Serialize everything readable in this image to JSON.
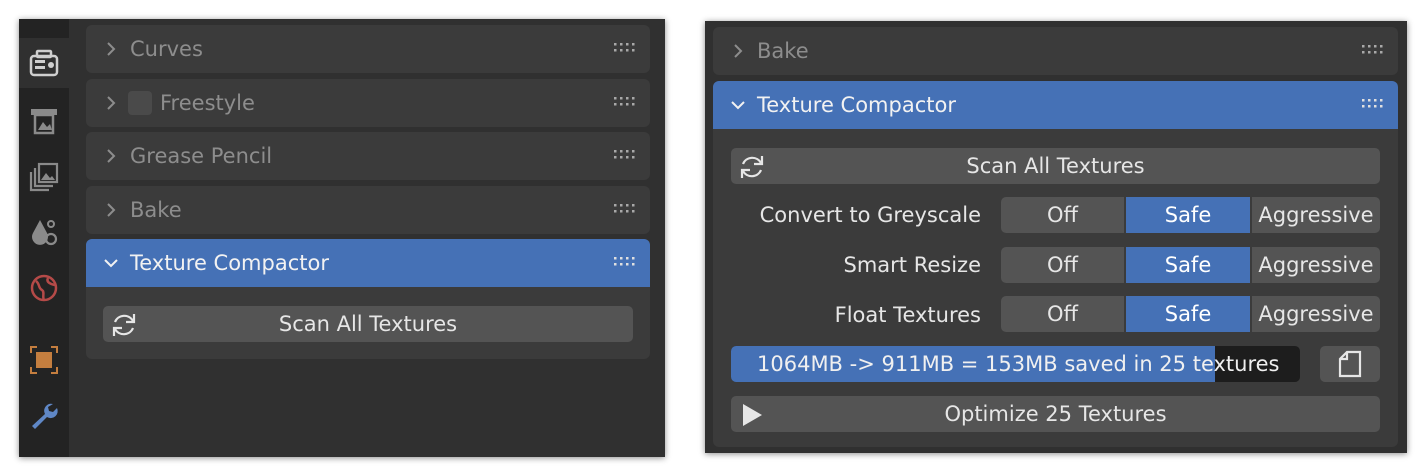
{
  "left_window": {
    "tabs": [
      {
        "icon": "render-properties-icon",
        "active": true
      },
      {
        "icon": "output-properties-icon",
        "active": false
      },
      {
        "icon": "view-layer-properties-icon",
        "active": false
      },
      {
        "icon": "scene-properties-icon",
        "active": false
      },
      {
        "icon": "world-properties-icon",
        "active": false
      },
      {
        "icon": "object-properties-icon",
        "active": false
      },
      {
        "icon": "modifier-wrench-icon",
        "active": false
      }
    ],
    "panels": [
      {
        "label": "Curves",
        "expanded": false
      },
      {
        "label": "Freestyle",
        "expanded": false,
        "has_checkbox": true
      },
      {
        "label": "Grease Pencil",
        "expanded": false
      },
      {
        "label": "Bake",
        "expanded": false
      },
      {
        "label": "Texture Compactor",
        "expanded": true
      }
    ],
    "scan_button_label": "Scan All Textures"
  },
  "right_window": {
    "bake_label": "Bake",
    "panel_label": "Texture Compactor",
    "scan_button_label": "Scan All Textures",
    "options": [
      {
        "label": "Convert to Greyscale",
        "choices": [
          "Off",
          "Safe",
          "Aggressive"
        ],
        "selected": "Safe"
      },
      {
        "label": "Smart Resize",
        "choices": [
          "Off",
          "Safe",
          "Aggressive"
        ],
        "selected": "Safe"
      },
      {
        "label": "Float Textures",
        "choices": [
          "Off",
          "Safe",
          "Aggressive"
        ],
        "selected": "Safe"
      }
    ],
    "progress": {
      "text": "1064MB -> 911MB = 153MB saved in 25 textures",
      "fraction": 0.85
    },
    "optimize_button_label": "Optimize 25 Textures"
  },
  "colors": {
    "accent": "#4571b6",
    "panel": "#3b3b3b",
    "background": "#303030",
    "button": "#545454"
  }
}
